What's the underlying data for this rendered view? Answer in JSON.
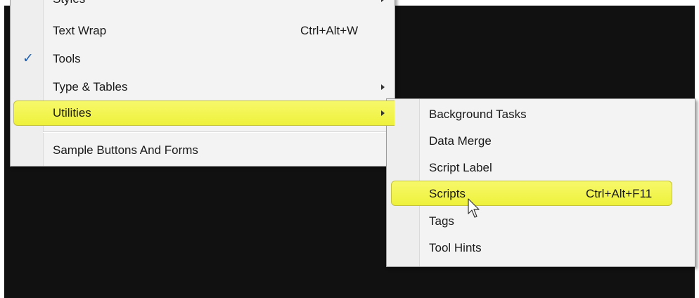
{
  "main_menu": {
    "items": [
      {
        "label": "Styles",
        "shortcut": "",
        "submenu": true,
        "checked": false
      },
      {
        "label": "Text Wrap",
        "shortcut": "Ctrl+Alt+W",
        "submenu": false,
        "checked": false
      },
      {
        "label": "Tools",
        "shortcut": "",
        "submenu": false,
        "checked": true
      },
      {
        "label": "Type & Tables",
        "shortcut": "",
        "submenu": true,
        "checked": false
      },
      {
        "label": "Utilities",
        "shortcut": "",
        "submenu": true,
        "checked": false,
        "highlighted": true
      },
      {
        "label": "Sample Buttons And Forms",
        "shortcut": "",
        "submenu": false,
        "checked": false
      }
    ],
    "check_glyph": "✓"
  },
  "utilities_submenu": {
    "items": [
      {
        "label": "Background Tasks",
        "shortcut": ""
      },
      {
        "label": "Data Merge",
        "shortcut": ""
      },
      {
        "label": "Script Label",
        "shortcut": ""
      },
      {
        "label": "Scripts",
        "shortcut": "Ctrl+Alt+F11",
        "highlighted": true
      },
      {
        "label": "Tags",
        "shortcut": ""
      },
      {
        "label": "Tool Hints",
        "shortcut": ""
      }
    ]
  },
  "colors": {
    "highlight": "#eef13b",
    "backdrop": "#111111",
    "menu_bg": "#f3f3f3",
    "check": "#1f5fb0"
  },
  "icons": {
    "submenu_arrow": "submenu-arrow-icon",
    "checkmark": "checkmark-icon",
    "cursor": "mouse-pointer-icon"
  }
}
